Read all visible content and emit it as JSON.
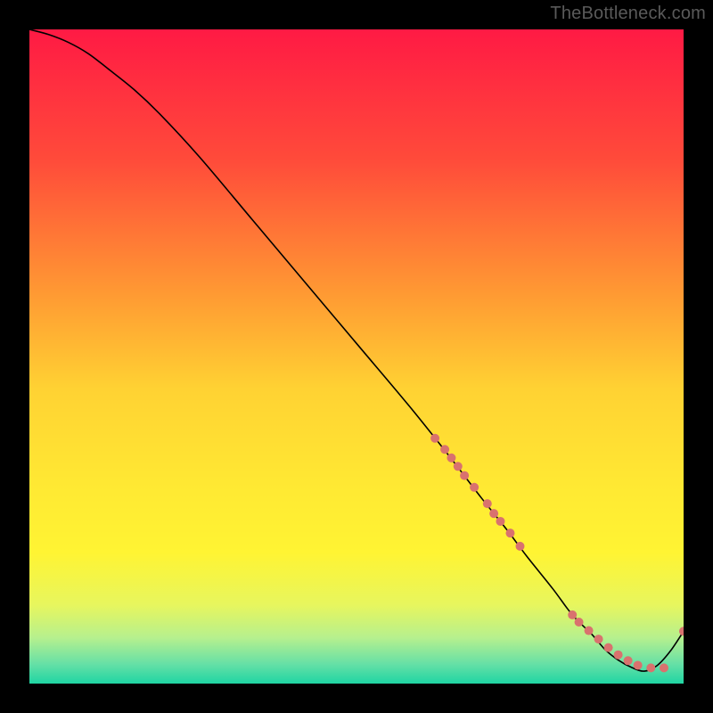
{
  "watermark": "TheBottleneck.com",
  "chart_data": {
    "type": "line",
    "title": "",
    "xlabel": "",
    "ylabel": "",
    "xlim": [
      0,
      100
    ],
    "ylim": [
      0,
      100
    ],
    "background_gradient_stops": [
      {
        "offset": 0.0,
        "color": "#ff1a44"
      },
      {
        "offset": 0.2,
        "color": "#ff4b3a"
      },
      {
        "offset": 0.4,
        "color": "#ff9833"
      },
      {
        "offset": 0.55,
        "color": "#ffd233"
      },
      {
        "offset": 0.7,
        "color": "#ffe933"
      },
      {
        "offset": 0.8,
        "color": "#fff433"
      },
      {
        "offset": 0.88,
        "color": "#e7f65e"
      },
      {
        "offset": 0.93,
        "color": "#b6f08e"
      },
      {
        "offset": 0.97,
        "color": "#66e0a6"
      },
      {
        "offset": 1.0,
        "color": "#1fd5a3"
      }
    ],
    "series": [
      {
        "name": "bottleneck-curve",
        "color": "#000000",
        "width": 1.6,
        "x": [
          0,
          3,
          6,
          9,
          12,
          16,
          20,
          26,
          34,
          42,
          50,
          58,
          64,
          69,
          73,
          76,
          80,
          83,
          86,
          88,
          90,
          92,
          94,
          96,
          98,
          100
        ],
        "y": [
          100,
          99.2,
          98.0,
          96.3,
          94.0,
          90.8,
          87.0,
          80.5,
          71.0,
          61.5,
          52.0,
          42.5,
          35.0,
          28.5,
          23.5,
          19.5,
          14.5,
          10.5,
          7.5,
          5.2,
          3.6,
          2.5,
          1.9,
          2.8,
          5.0,
          8.0
        ]
      }
    ],
    "marker_clusters": [
      {
        "name": "cluster-upper",
        "color": "#d9726e",
        "r": 5,
        "points": [
          {
            "x": 62,
            "y": 37.5
          },
          {
            "x": 63.5,
            "y": 35.8
          },
          {
            "x": 64.5,
            "y": 34.5
          },
          {
            "x": 65.5,
            "y": 33.2
          },
          {
            "x": 66.5,
            "y": 31.8
          },
          {
            "x": 68,
            "y": 30.0
          }
        ]
      },
      {
        "name": "cluster-mid",
        "color": "#d9726e",
        "r": 5,
        "points": [
          {
            "x": 70,
            "y": 27.5
          },
          {
            "x": 71,
            "y": 26.0
          },
          {
            "x": 72,
            "y": 24.8
          },
          {
            "x": 73.5,
            "y": 23.0
          },
          {
            "x": 75,
            "y": 21.0
          }
        ]
      },
      {
        "name": "cluster-bottom",
        "color": "#d9726e",
        "r": 5,
        "points": [
          {
            "x": 83,
            "y": 10.5
          },
          {
            "x": 84,
            "y": 9.4
          },
          {
            "x": 85.5,
            "y": 8.1
          },
          {
            "x": 87,
            "y": 6.8
          },
          {
            "x": 88.5,
            "y": 5.5
          },
          {
            "x": 90,
            "y": 4.4
          },
          {
            "x": 91.5,
            "y": 3.5
          },
          {
            "x": 93,
            "y": 2.8
          },
          {
            "x": 95,
            "y": 2.4
          },
          {
            "x": 97,
            "y": 2.4
          }
        ]
      },
      {
        "name": "cluster-tail",
        "color": "#d9726e",
        "r": 5,
        "points": [
          {
            "x": 100,
            "y": 8.0
          }
        ]
      }
    ]
  }
}
